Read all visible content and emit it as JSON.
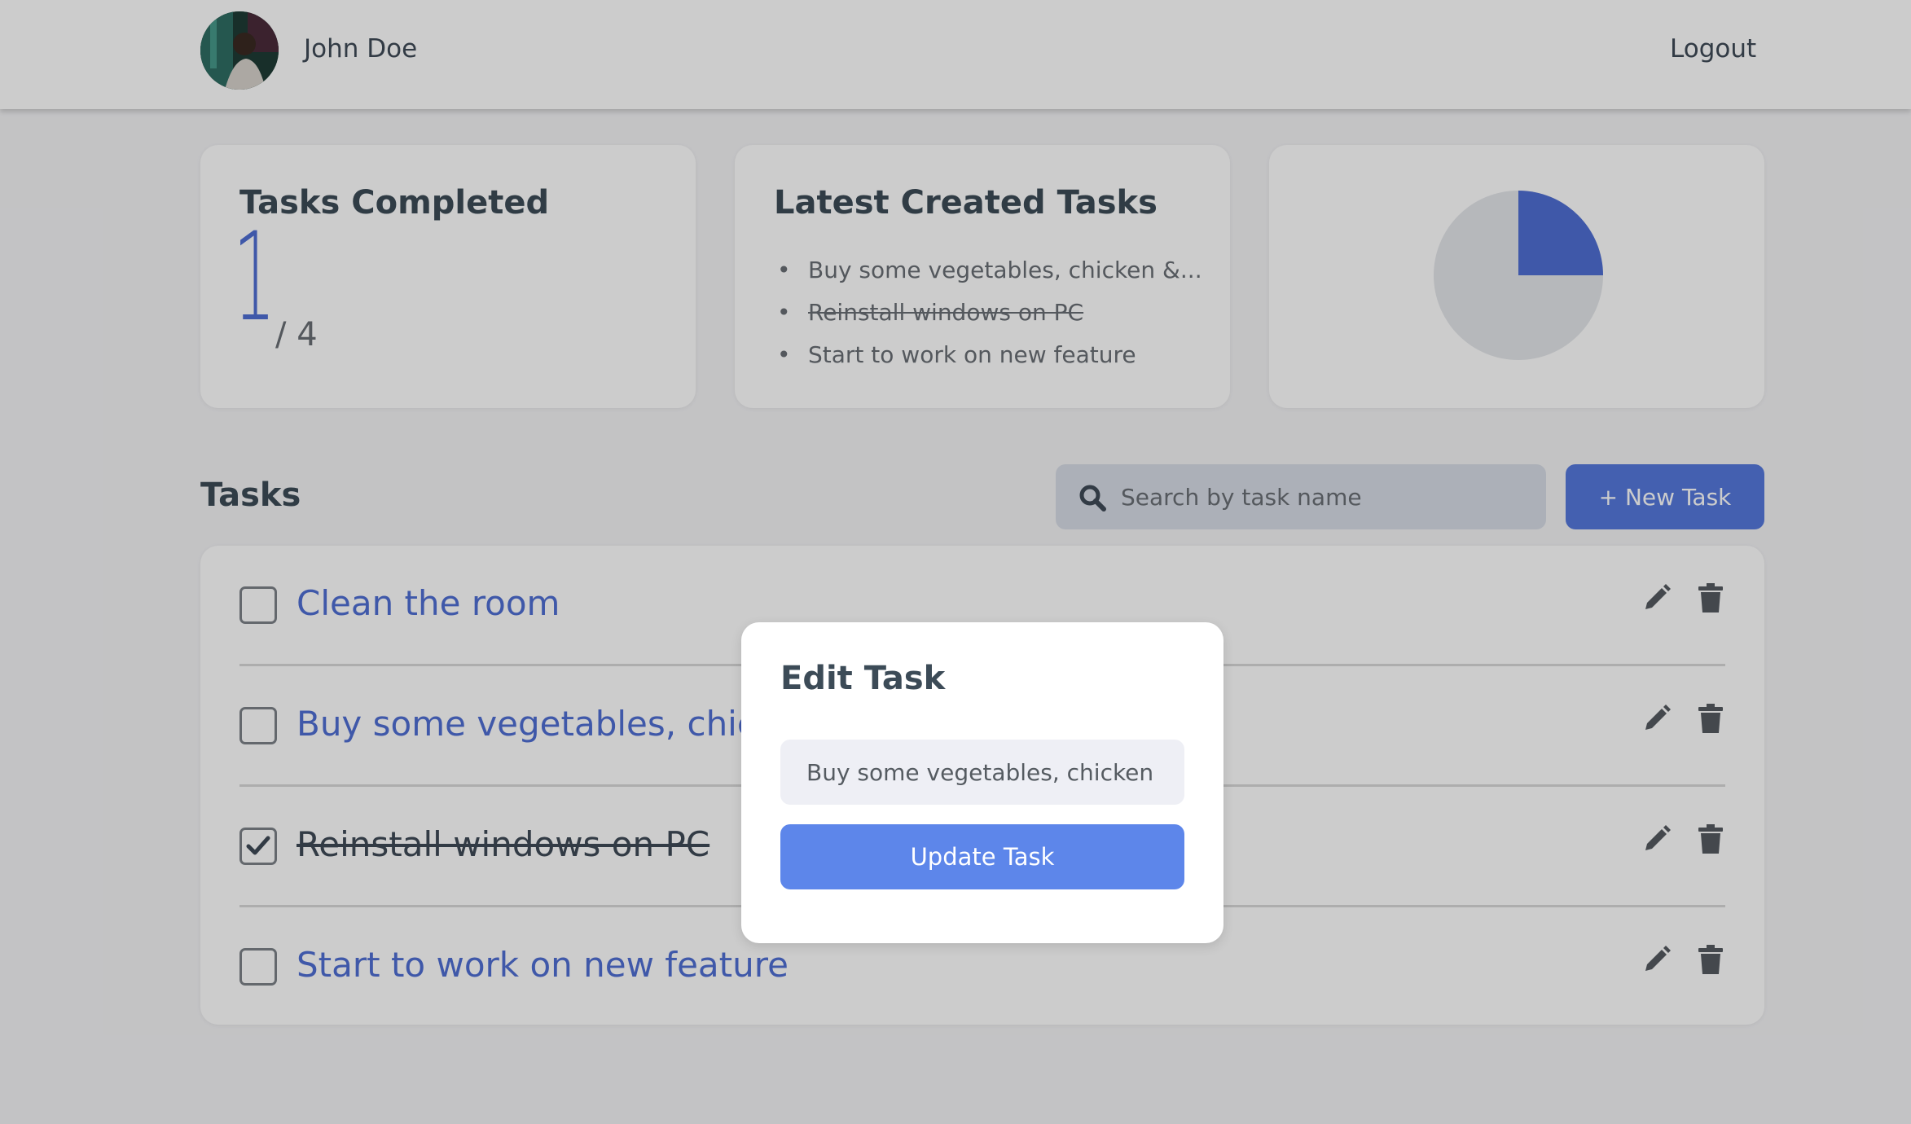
{
  "header": {
    "user_name": "John Doe",
    "logout_label": "Logout"
  },
  "cards": {
    "completed": {
      "title": "Tasks Completed",
      "count": "1",
      "total": "/ 4"
    },
    "latest": {
      "title": "Latest Created Tasks",
      "items": [
        {
          "label": "Buy some vegetables, chicken &...",
          "completed": false
        },
        {
          "label": "Reinstall windows on PC",
          "completed": true
        },
        {
          "label": "Start to work on new feature",
          "completed": false
        }
      ]
    },
    "progress_pie": {
      "completed_fraction": 0.25,
      "colors": {
        "completed": "#4f6fd4",
        "remaining": "#e4e6ea"
      }
    }
  },
  "tasks_section": {
    "title": "Tasks",
    "search_placeholder": "Search by task name",
    "new_task_label": "+ New Task",
    "tasks": [
      {
        "label": "Clean the room",
        "completed": false
      },
      {
        "label": "Buy some vegetables, chicken & chips",
        "completed": false
      },
      {
        "label": "Reinstall windows on PC",
        "completed": true
      },
      {
        "label": "Start to work on new feature",
        "completed": false
      }
    ]
  },
  "modal": {
    "title": "Edit Task",
    "input_value": "Buy some vegetables, chicken",
    "update_label": "Update Task"
  },
  "colors": {
    "accent": "#4f6fd4",
    "button": "#5579dd",
    "update_button": "#5d86ea",
    "page_bg": "#f4f4f6",
    "text_dark": "#3c4b57"
  },
  "icons": {
    "search": "search-icon",
    "edit": "pencil-icon",
    "delete": "trash-icon",
    "check": "checkmark-icon"
  }
}
